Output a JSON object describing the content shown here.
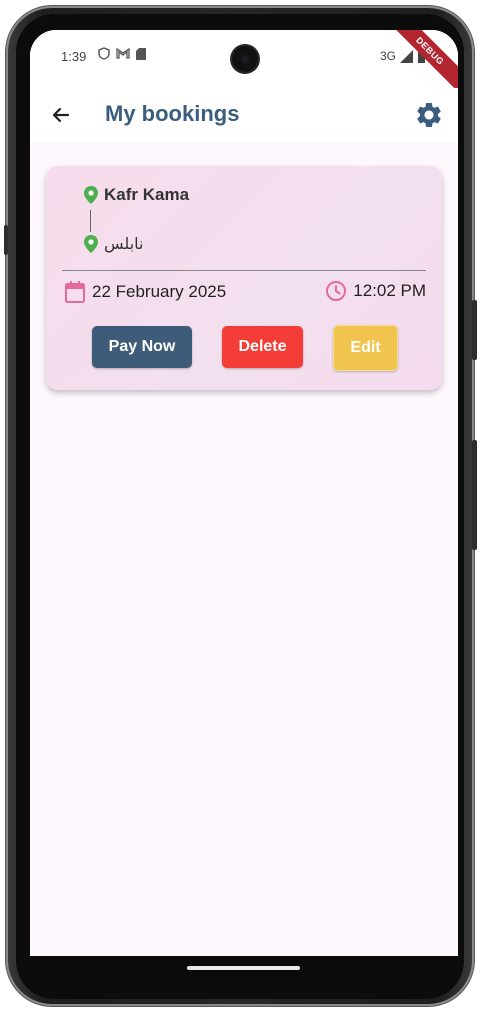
{
  "status_bar": {
    "time": "1:39",
    "network": "3G",
    "debug_label": "DEBUG"
  },
  "app_bar": {
    "title": "My bookings"
  },
  "booking": {
    "from": "Kafr Kama",
    "to": "نابلس",
    "date": "22 February 2025",
    "time": "12:02 PM",
    "buttons": {
      "pay": "Pay Now",
      "delete": "Delete",
      "edit": "Edit"
    }
  },
  "colors": {
    "title": "#3b5d7e",
    "location_pin": "#4caf50",
    "calendar_icon": "#e56a9a",
    "clock_icon": "#e56a9a",
    "pay_button": "#3e5b79",
    "delete_button": "#f33d36",
    "edit_button": "#f1c44d"
  },
  "icons": {
    "back": "arrow-left-icon",
    "settings": "gear-icon",
    "pin": "map-pin-icon",
    "calendar": "calendar-icon",
    "clock": "clock-icon"
  }
}
